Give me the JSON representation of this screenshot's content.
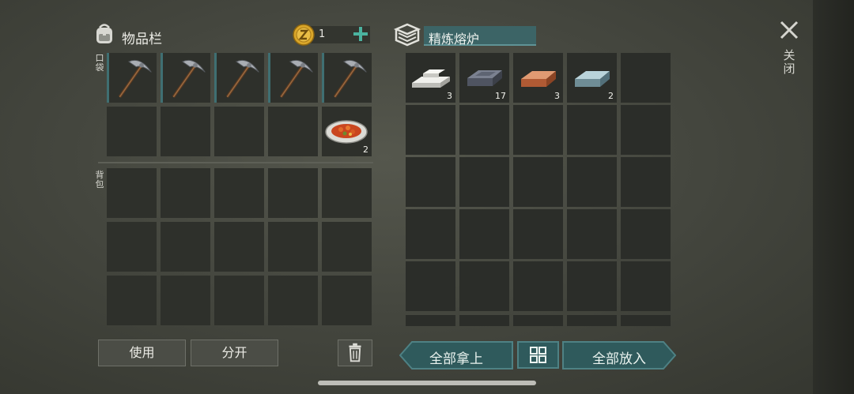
{
  "header": {
    "inventory_title": "物品栏",
    "coin_count": "1",
    "furnace_name": "精炼熔炉",
    "close_label": "关闭"
  },
  "labels": {
    "pocket": "口袋",
    "backpack": "背包"
  },
  "pocket_row1": [
    {
      "item": "pickaxe",
      "qty": ""
    },
    {
      "item": "pickaxe",
      "qty": ""
    },
    {
      "item": "pickaxe",
      "qty": ""
    },
    {
      "item": "pickaxe",
      "qty": ""
    },
    {
      "item": "pickaxe",
      "qty": ""
    }
  ],
  "pocket_row2": [
    {
      "item": "",
      "qty": ""
    },
    {
      "item": "",
      "qty": ""
    },
    {
      "item": "",
      "qty": ""
    },
    {
      "item": "",
      "qty": ""
    },
    {
      "item": "food-plate",
      "qty": "2"
    }
  ],
  "furnace_row1": [
    {
      "item": "silver-ingot",
      "qty": "3"
    },
    {
      "item": "iron-ingot",
      "qty": "17"
    },
    {
      "item": "copper-ingot",
      "qty": "3"
    },
    {
      "item": "steel-ingot",
      "qty": "2"
    },
    {
      "item": "",
      "qty": ""
    }
  ],
  "buttons": {
    "use": "使用",
    "split": "分开",
    "take_all": "全部拿上",
    "put_all": "全部放入"
  },
  "colors": {
    "accent_teal": "#3c6466",
    "button_teal": "#2f5a5c",
    "coin_gold": "#d9a62a"
  },
  "icons": {
    "bag": "backpack-icon",
    "coin": "coin-icon",
    "plus": "plus-icon",
    "furnace": "furnace-icon",
    "close": "close-icon",
    "trash": "trash-icon",
    "sort": "sort-grid-icon"
  }
}
